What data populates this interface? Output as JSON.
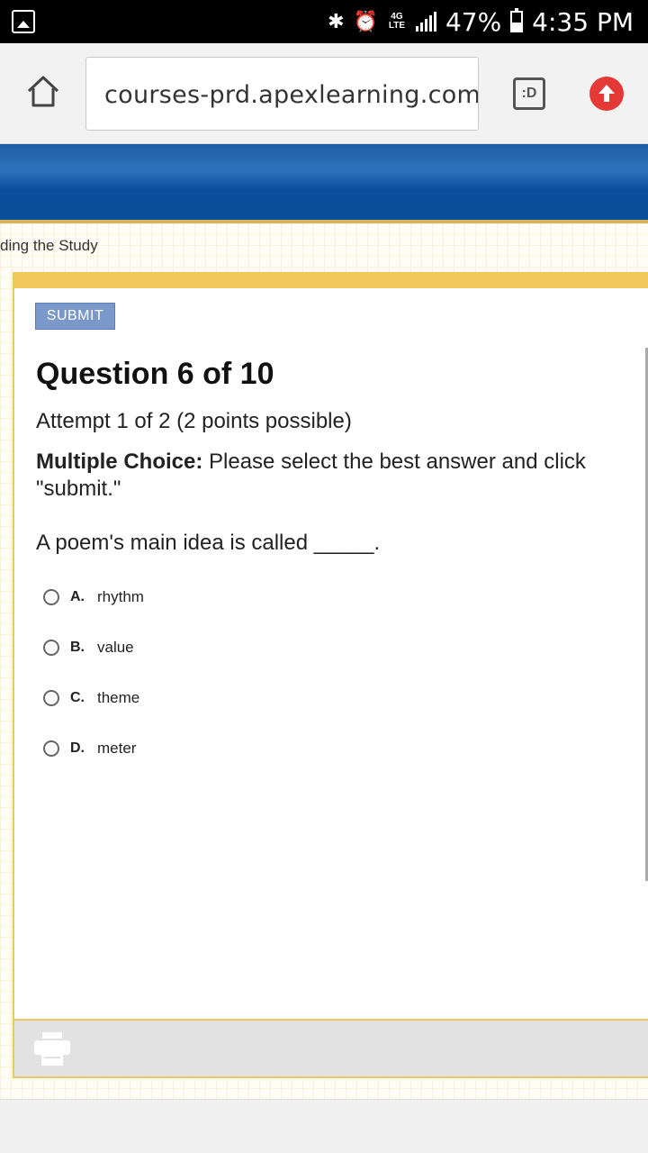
{
  "status_bar": {
    "net": "4G LTE",
    "battery": "47%",
    "time": "4:35 PM"
  },
  "browser": {
    "url": "courses-prd.apexlearning.com/",
    "tab_label": ":D"
  },
  "breadcrumb": "ding the Study",
  "quiz": {
    "submit_label": "SUBMIT",
    "title": "Question 6 of 10",
    "attempt": "Attempt 1 of 2 (2 points possible)",
    "instruction_bold": "Multiple Choice:",
    "instruction_text": " Please select the best answer and click \"submit.\"",
    "prompt": "A poem's main idea is called _____.",
    "options": [
      {
        "letter": "A.",
        "text": "rhythm"
      },
      {
        "letter": "B.",
        "text": "value"
      },
      {
        "letter": "C.",
        "text": "theme"
      },
      {
        "letter": "D.",
        "text": "meter"
      }
    ]
  },
  "colors": {
    "banner": "#1f5ea6",
    "panel_border": "#f2c75c",
    "submit_button": "#7a98c9",
    "upload_button": "#e53935"
  }
}
